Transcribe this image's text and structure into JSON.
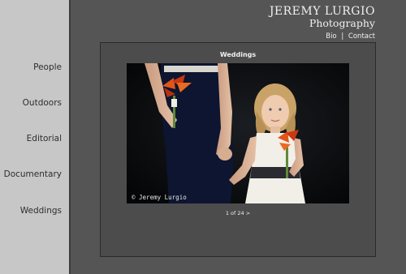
{
  "header": {
    "name": "JEREMY LURGIO",
    "subtitle": "Photography",
    "links": [
      {
        "label": "Bio"
      },
      {
        "label": "Contact"
      }
    ],
    "separator": "|"
  },
  "sidebar": {
    "items": [
      {
        "label": "People"
      },
      {
        "label": "Outdoors"
      },
      {
        "label": "Editorial"
      },
      {
        "label": "Documentary"
      },
      {
        "label": "Weddings"
      }
    ]
  },
  "gallery": {
    "title": "Weddings",
    "photo_credit": "© Jeremy Lurgio",
    "pager": "1 of 24 >"
  },
  "colors": {
    "sidebar_bg": "#c7c7c7",
    "page_bg": "#555555",
    "panel_bg": "#4c4c4c",
    "text_light": "#f0f0f0"
  }
}
